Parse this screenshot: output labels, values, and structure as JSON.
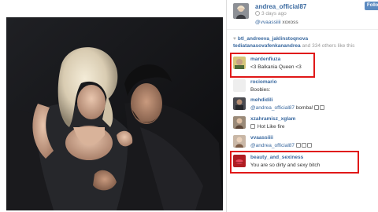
{
  "post": {
    "username": "andrea_official87",
    "time_ago": "3 days ago",
    "caption_mention": "@vvaassiiii",
    "caption_text": "xoxoss",
    "follow_label": "Follow"
  },
  "likes": {
    "likers": "btl_andreeva_jaklinstoqnova",
    "likers_2": "tediatanasovafenkanandrea",
    "others_prefix": "and",
    "others_count": "334",
    "others_suffix": "others like this"
  },
  "comments": [
    {
      "user": "mardenfiuza",
      "text": "<3 Balkania Queen <3",
      "highlighted": true
    },
    {
      "user": "rociomario",
      "text": "Boobies:",
      "highlighted": false
    },
    {
      "user": "mehdidili",
      "mention": "@andrea_official87",
      "text": "bomba!",
      "highlighted": false
    },
    {
      "user": "xzahramisz_xglam",
      "text": "Hot Like fire",
      "highlighted": false
    },
    {
      "user": "vvaassiiii",
      "mention": "@andrea_official87",
      "text": "",
      "highlighted": false
    },
    {
      "user": "beauty_and_sexiness",
      "text": "You are so dirty and sexy bitch",
      "highlighted": true
    }
  ],
  "colors": {
    "link_blue": "#3b6aa0",
    "highlight_red": "#e01818",
    "follow_button": "#5b8ac0"
  }
}
